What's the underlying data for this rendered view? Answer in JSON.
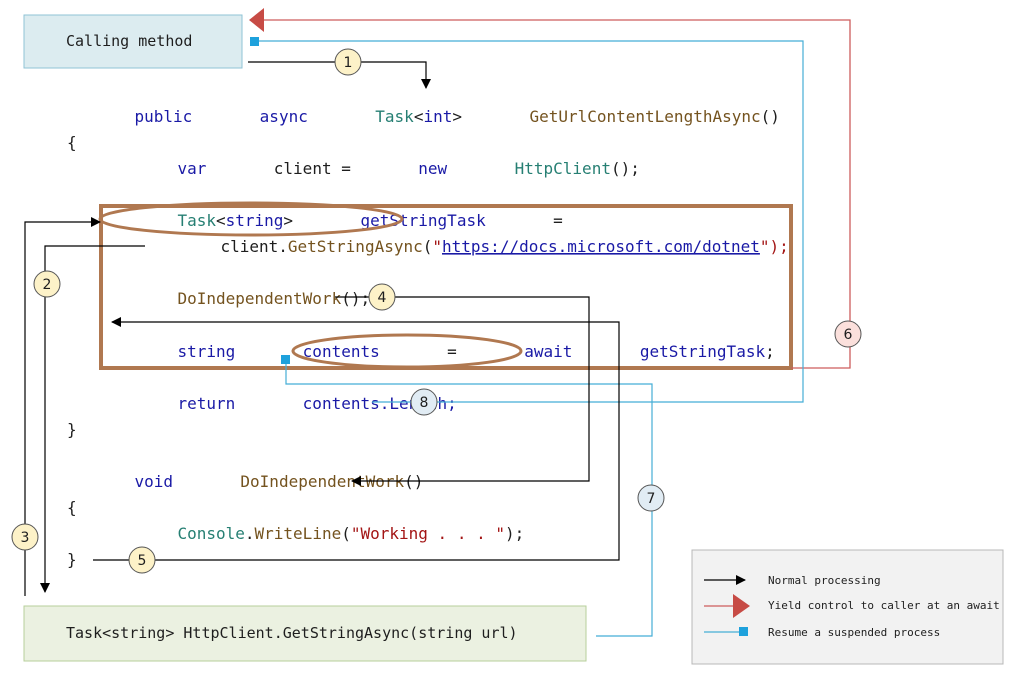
{
  "boxes": {
    "calling_method": "Calling method",
    "get_string_async": "Task<string> HttpClient.GetStringAsync(string url)"
  },
  "code": {
    "kw_public": "public",
    "kw_async": "async",
    "type_task": "Task",
    "lt1": "<",
    "type_int": "int",
    "gt1": ">",
    "method_get_url": "GetUrlContentLengthAsync",
    "parens1": "()",
    "brace_open1": "{",
    "kw_var": "var",
    "client_eq": "client =",
    "kw_new": "new",
    "type_httpclient": "HttpClient",
    "parens_semi1": "();",
    "type_task2": "Task",
    "lt2": "<",
    "kw_string1": "string",
    "gt2": ">",
    "var_getstringtask": "getStringTask",
    "eq1": "=",
    "client_dot": "client.",
    "method_getstringasync": "GetStringAsync",
    "paren_open": "(",
    "quote_open": "\"",
    "url": "https://docs.microsoft.com/dotnet",
    "quote_close_paren": "\");",
    "method_doindep1": "DoIndependentWork",
    "parens_semi2": "();",
    "kw_string2": "string",
    "var_contents": "contents",
    "eq2": "=",
    "kw_await": "await",
    "var_getstringtask2": "getStringTask",
    "semi1": ";",
    "kw_return": "return",
    "contents_length": "contents.Length;",
    "brace_close1": "}",
    "kw_void": "void",
    "method_doindep2": "DoIndependentWork",
    "parens2": "()",
    "brace_open2": "{",
    "type_console": "Console",
    "dot": ".",
    "method_writeline": "WriteLine",
    "paren_open2": "(",
    "str_working": "\"Working . . . \"",
    "paren_close_semi": ");",
    "brace_close2": "}"
  },
  "steps": [
    "1",
    "2",
    "3",
    "4",
    "5",
    "6",
    "7",
    "8"
  ],
  "legend": {
    "normal": "Normal processing",
    "yield": "Yield control to caller at an await",
    "resume": "Resume a suspended process"
  },
  "colors": {
    "normal": "#000000",
    "yield": "#cd5c5c",
    "resume": "#45aed6",
    "highlight": "#b07850",
    "step_fill": "#fdf2c8",
    "step6_fill": "#fbe0dc",
    "step7_fill": "#e1ecf4"
  }
}
